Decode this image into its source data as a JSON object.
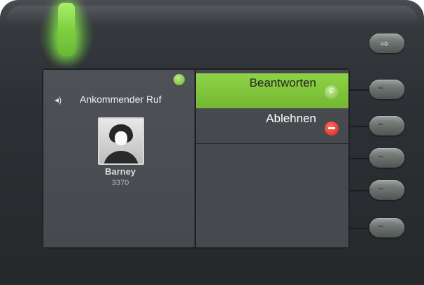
{
  "screen": {
    "header": {
      "title": "Ankommender Ruf",
      "speaker_icon": "speaker-icon",
      "status_icon": "presence-dot"
    },
    "caller": {
      "name": "Barney",
      "number": "3370",
      "avatar_icon": "person-avatar-icon"
    },
    "options": [
      {
        "label": "Beantworten",
        "icon": "phone-accept-icon",
        "selected": true
      },
      {
        "label": "Ablehnen",
        "icon": "call-reject-icon",
        "selected": false
      }
    ]
  },
  "hardware": {
    "leave_button_icon": "exit-icon",
    "softkeys": [
      "softkey-1",
      "softkey-2",
      "softkey-3",
      "softkey-4",
      "softkey-5"
    ],
    "led_color": "#7fd040"
  },
  "colors": {
    "accent_selected": "#7fc43c",
    "reject": "#d52a20",
    "screen_bg": "#46494e"
  }
}
